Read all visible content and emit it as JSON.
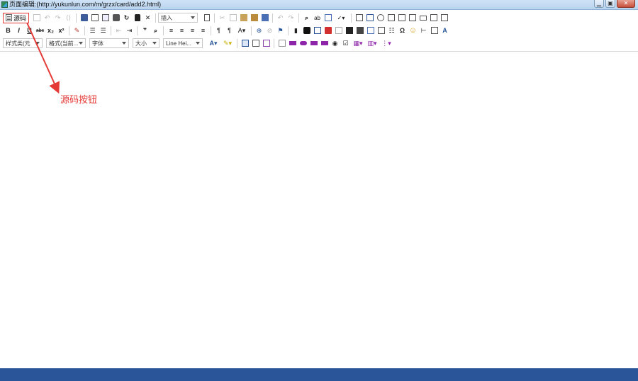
{
  "window": {
    "title": "页面编辑:(http://yukunlun.com/m/grzx/card/add2.html)",
    "controls": {
      "minimize": "▁",
      "maximize": "▣",
      "close": "✕"
    }
  },
  "toolbar": {
    "source_label": "源码",
    "insert_label": "插入",
    "style_combo": "样式类(元",
    "format_combo": "格式(当前...",
    "font_combo": "字体",
    "size_combo": "大小",
    "lineheight_combo": "Line Hei...",
    "bold": "B",
    "italic": "I",
    "underline": "U",
    "strike": "abc",
    "subscript": "x₂",
    "superscript": "x²",
    "omega": "Ω",
    "quote": "❞",
    "smiley": "☺"
  },
  "annotation": {
    "label": "源码按钮",
    "color": "#e53935"
  },
  "colors": {
    "titlebar": "#c4daf2",
    "bottom_bar": "#2a5699",
    "accent_red": "#e53935"
  }
}
